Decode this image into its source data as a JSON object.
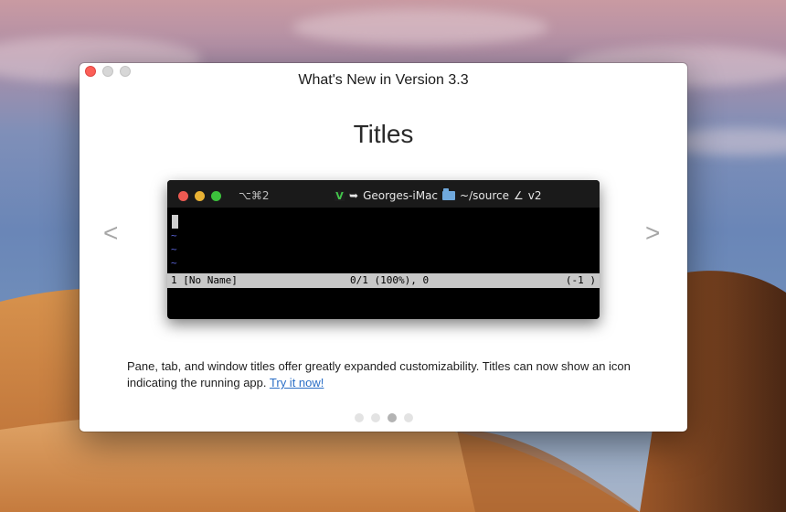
{
  "window": {
    "title": "What's New in Version 3.3"
  },
  "slide": {
    "title": "Titles",
    "prev_arrow": "<",
    "next_arrow": ">",
    "description": "Pane, tab, and window titles offer greatly expanded customizability. Titles can now show an icon indicating the running app.",
    "link_text": "Try it now!",
    "page_count": 4,
    "active_page": 3
  },
  "terminal": {
    "shortcut": "⌥⌘2",
    "app_icon": "vim-icon",
    "arrow": "➥",
    "host": "Georges-iMac",
    "folder_icon": "folder-icon",
    "path": "~/source",
    "branch_symbol": "∠",
    "branch": "v2",
    "tilde": "~",
    "status_left": "1 [No Name]",
    "status_middle": "0/1 (100%), 0",
    "status_right": "(-1 )"
  },
  "colors": {
    "close": "#fc5f57",
    "link": "#2a6ec6",
    "vim_tilde": "#5a63d6"
  }
}
